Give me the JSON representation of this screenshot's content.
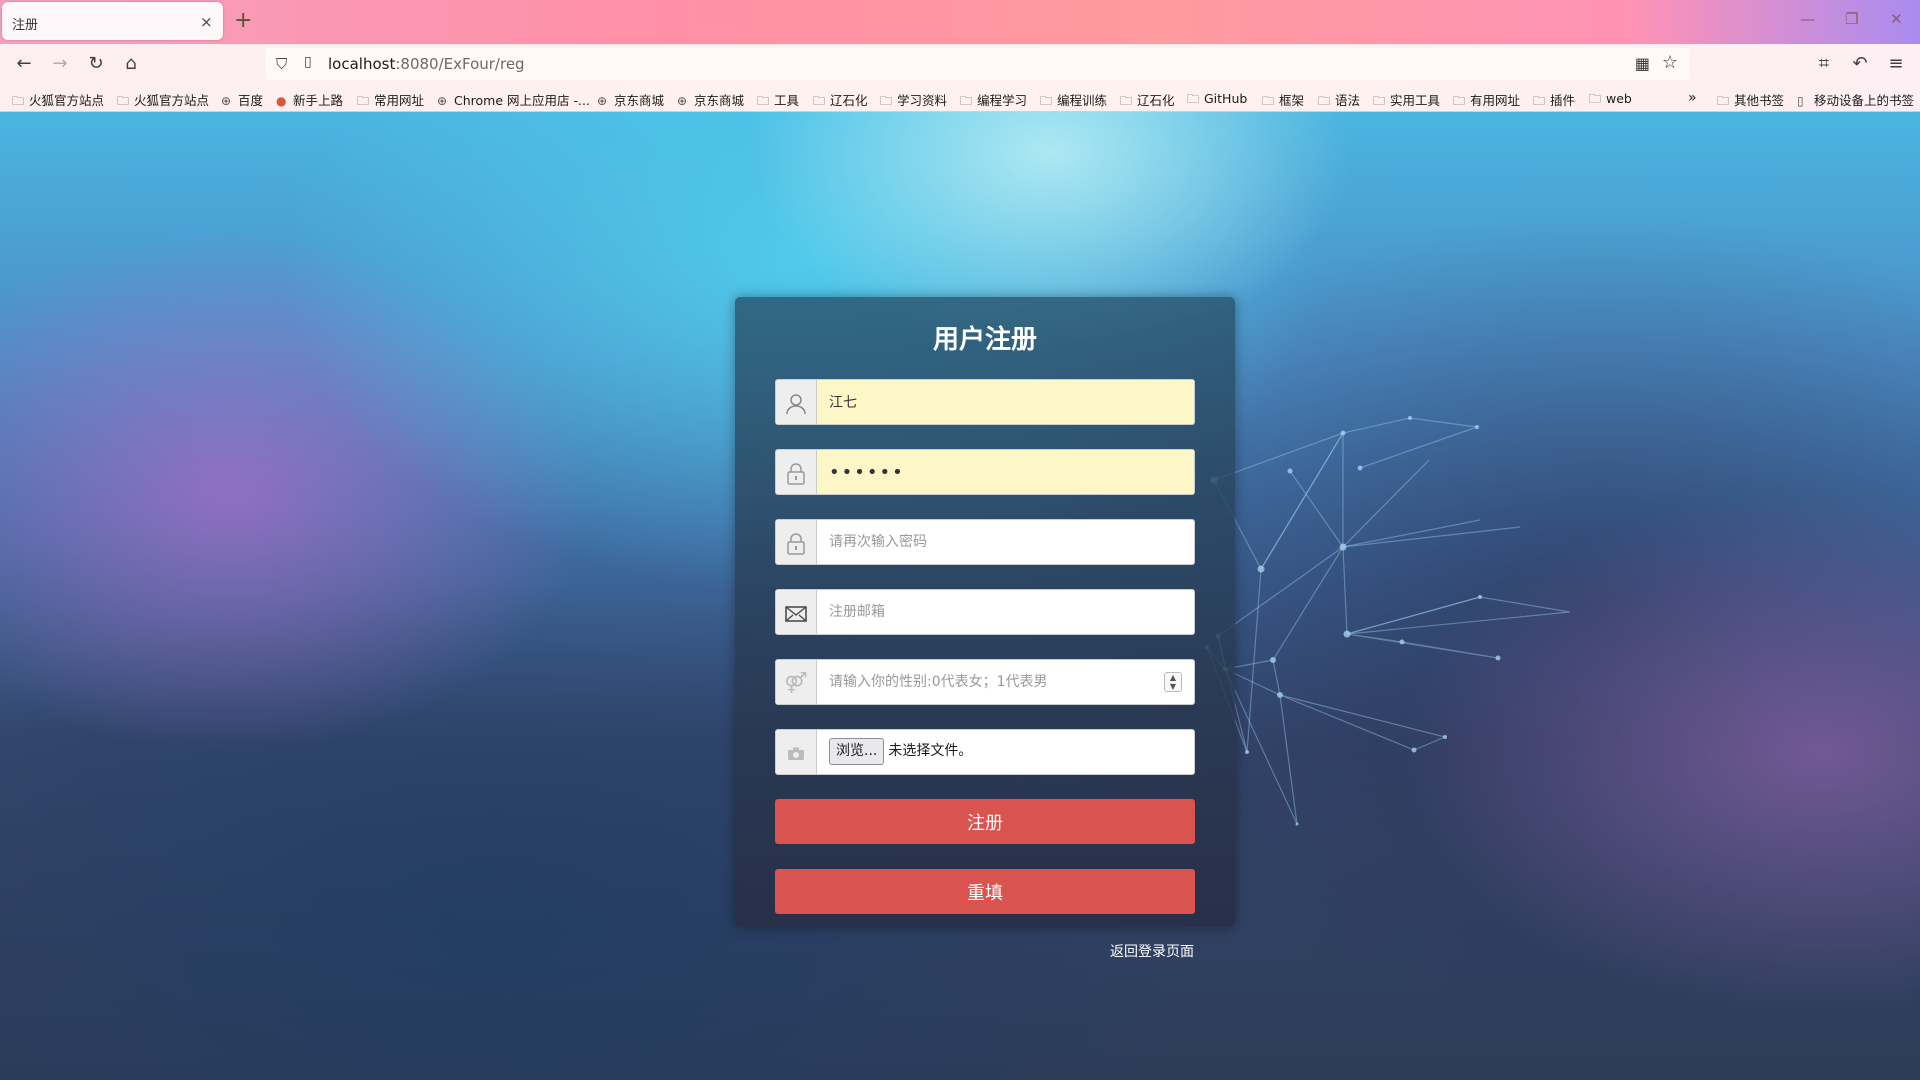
{
  "browser": {
    "tab_title": "注册",
    "tab_close": "×",
    "new_tab": "+",
    "url_host": "localhost",
    "url_path": ":8080/ExFour/reg",
    "bookmarks": [
      {
        "label": "火狐官方站点",
        "icon": "folder-icon"
      },
      {
        "label": "火狐官方站点",
        "icon": "folder-icon"
      },
      {
        "label": "百度",
        "icon": "globe-icon"
      },
      {
        "label": "新手上路",
        "icon": "firefox-icon"
      },
      {
        "label": "常用网址",
        "icon": "folder-icon"
      },
      {
        "label": "Chrome 网上应用店 -...",
        "icon": "globe-icon"
      },
      {
        "label": "京东商城",
        "icon": "globe-icon"
      },
      {
        "label": "京东商城",
        "icon": "globe-icon"
      },
      {
        "label": "工具",
        "icon": "folder-icon"
      },
      {
        "label": "辽石化",
        "icon": "folder-icon"
      },
      {
        "label": "学习资料",
        "icon": "folder-icon"
      },
      {
        "label": "编程学习",
        "icon": "folder-icon"
      },
      {
        "label": "编程训练",
        "icon": "folder-icon"
      },
      {
        "label": "辽石化",
        "icon": "folder-icon"
      },
      {
        "label": "GitHub",
        "icon": "folder-icon"
      },
      {
        "label": "框架",
        "icon": "folder-icon"
      },
      {
        "label": "语法",
        "icon": "folder-icon"
      },
      {
        "label": "实用工具",
        "icon": "folder-icon"
      },
      {
        "label": "有用网址",
        "icon": "folder-icon"
      },
      {
        "label": "插件",
        "icon": "folder-icon"
      },
      {
        "label": "web",
        "icon": "folder-icon"
      }
    ],
    "other_bookmarks": "其他书签",
    "mobile_bookmarks": "移动设备上的书签"
  },
  "form": {
    "title": "用户注册",
    "username_value": "江七",
    "password_value": "••••••",
    "confirm_placeholder": "请再次输入密码",
    "email_placeholder": "注册邮箱",
    "gender_placeholder": "请输入你的性别:0代表女；1代表男",
    "file_button": "浏览...",
    "file_status": "未选择文件。",
    "submit_label": "注册",
    "reset_label": "重填",
    "back_link": "返回登录页面"
  },
  "colors": {
    "button": "#d9534f",
    "autofill": "#fdf6c6"
  }
}
